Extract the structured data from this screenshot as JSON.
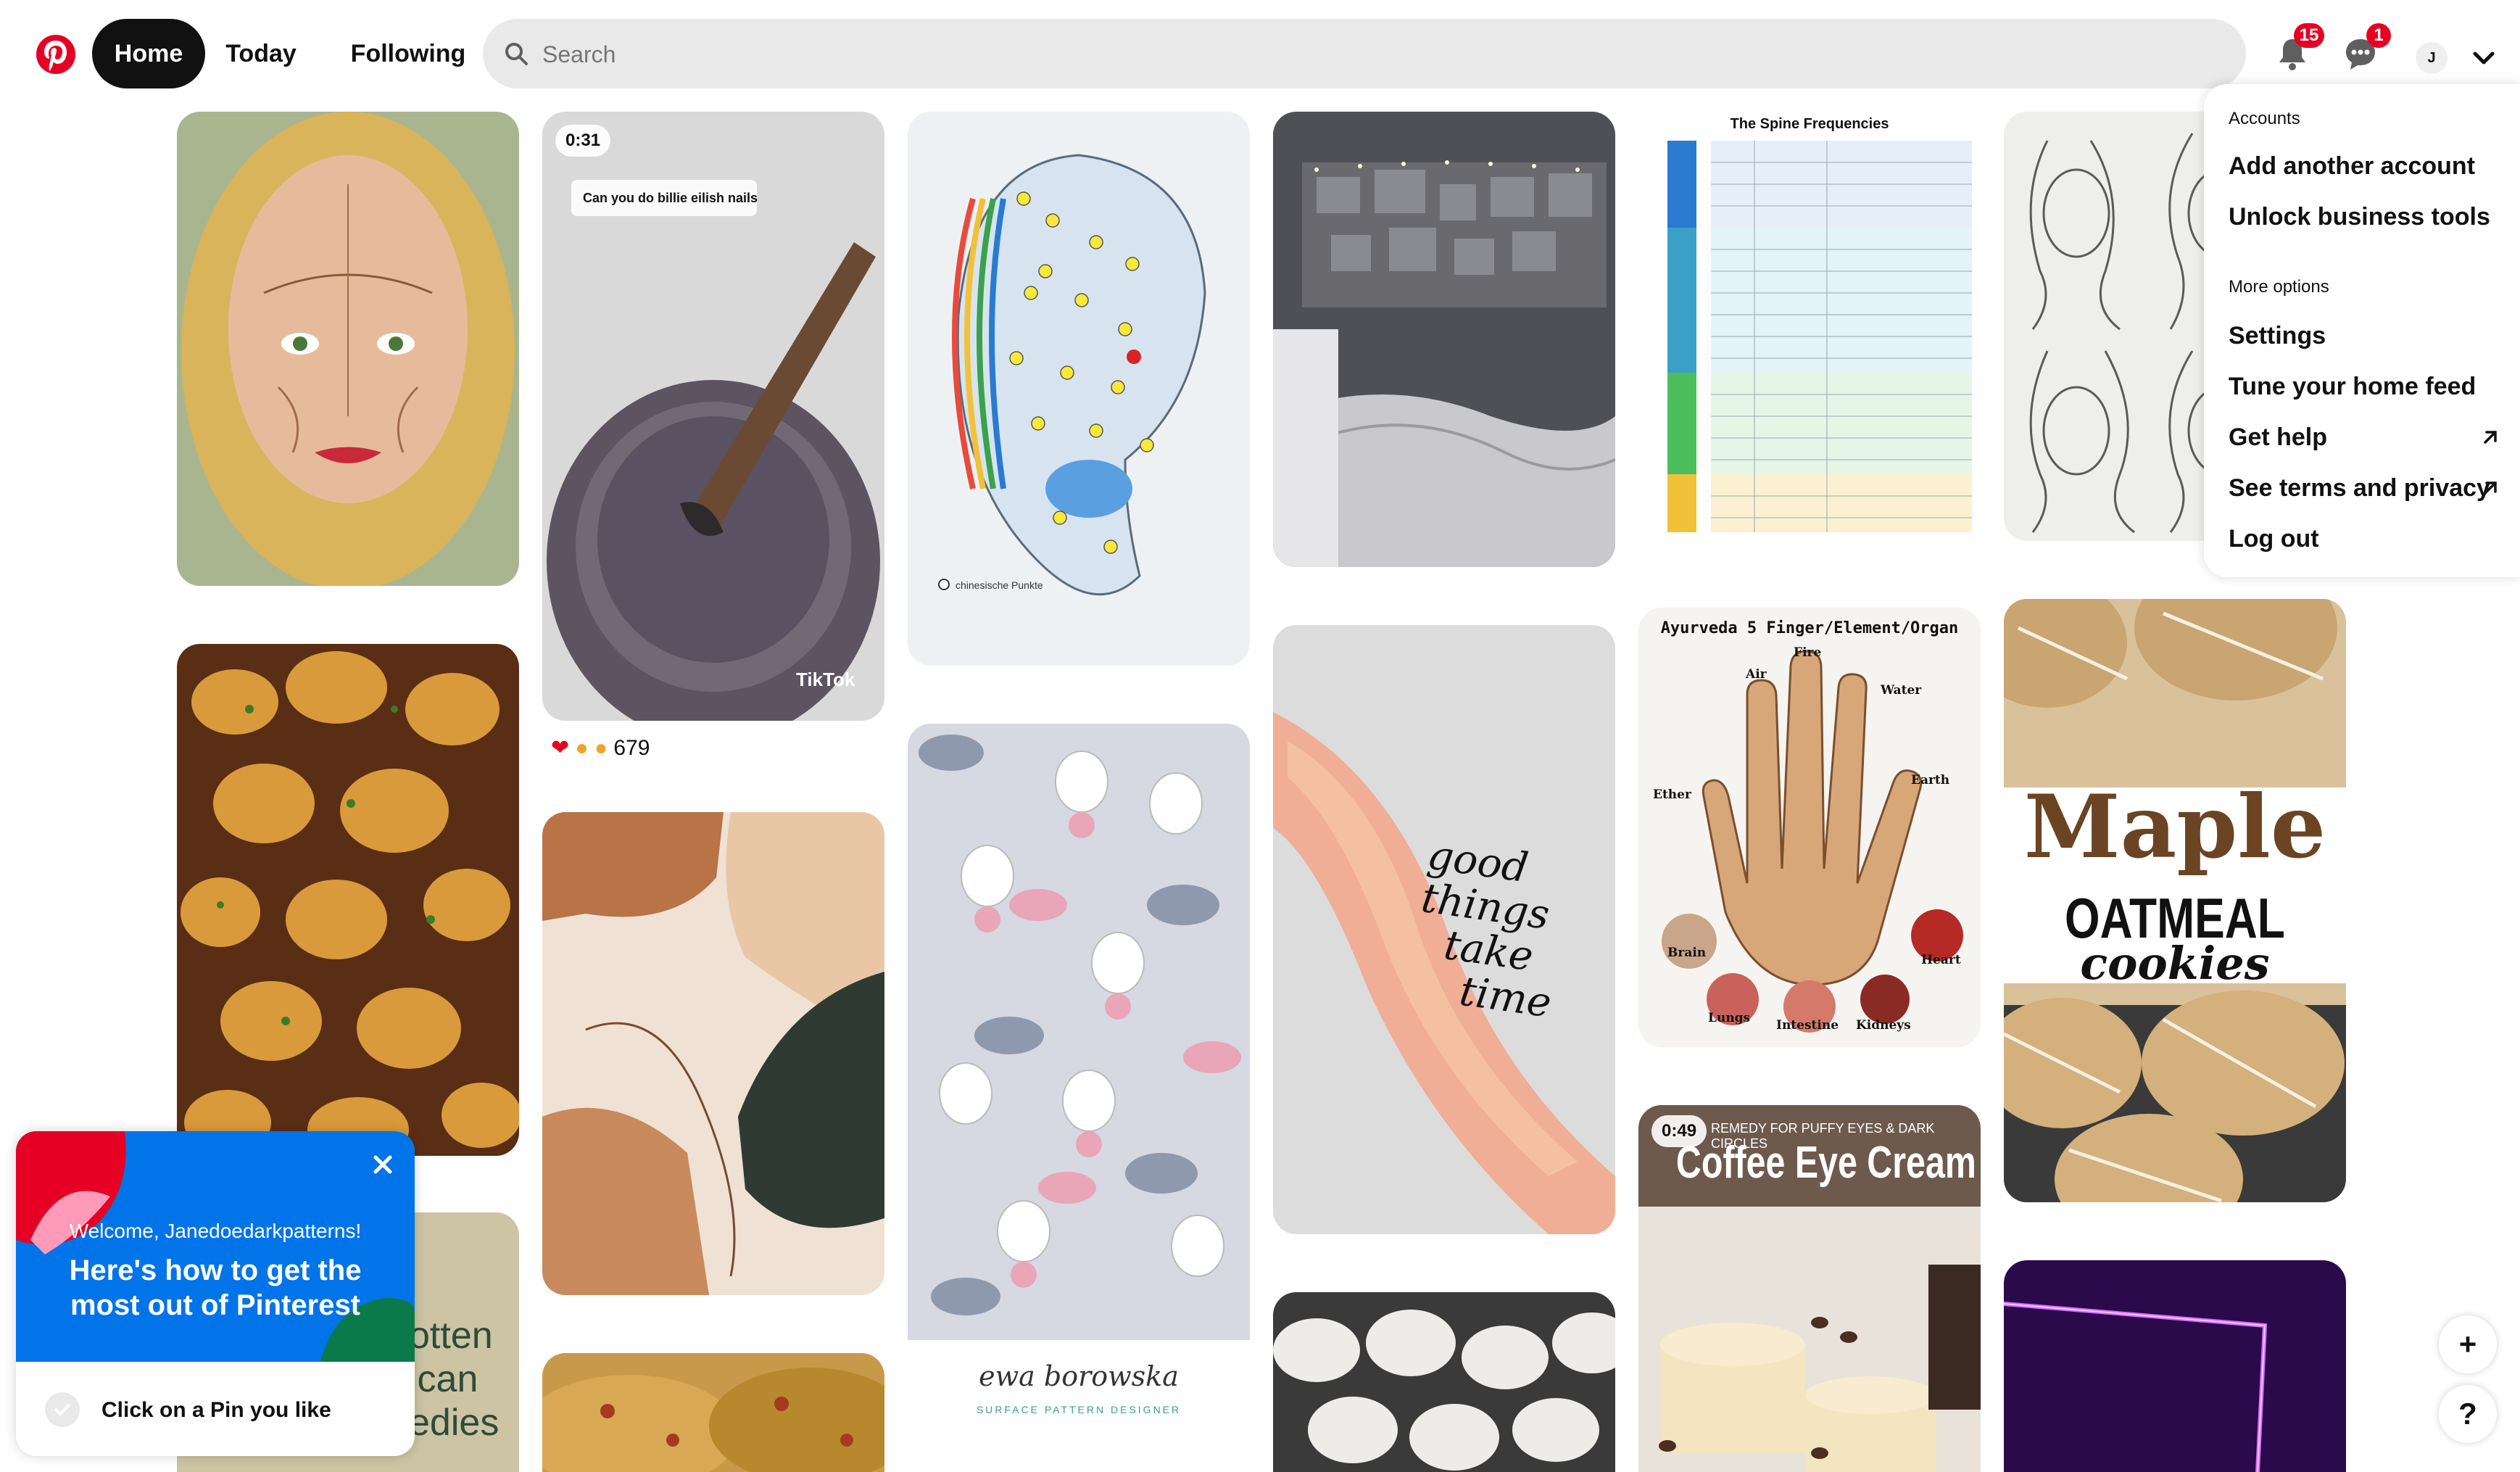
{
  "nav": {
    "home": "Home",
    "today": "Today",
    "following": "Following"
  },
  "search": {
    "placeholder": "Search"
  },
  "header": {
    "notifications_count": "15",
    "messages_count": "1",
    "avatar_initial": "J"
  },
  "pins": {
    "video1": {
      "duration": "0:31",
      "reply_text": "Can you do billie eilish nails",
      "source": "TikTok",
      "reaction_count": "679"
    },
    "ear": {
      "note": "chinesische Punkte"
    },
    "spine": {
      "title": "The Spine Frequencies"
    },
    "affirmation": {
      "line1": "good",
      "line2": "things",
      "line3": "take",
      "line4": "time"
    },
    "ayurveda": {
      "title": "Ayurveda 5 Finger/Element/Organ",
      "fire": "Fire",
      "air": "Air",
      "water": "Water",
      "ether": "Ether",
      "earth": "Earth",
      "brain": "Brain",
      "lungs": "Lungs",
      "intestine": "Intestine",
      "kidneys": "Kidneys",
      "heart": "Heart"
    },
    "cookies": {
      "line1": "Maple",
      "line2": "OATMEAL",
      "line3": "cookies"
    },
    "coffee": {
      "duration": "0:49",
      "tagline": "REMEDY FOR PUFFY EYES & DARK CIRCLES",
      "title": "Coffee Eye Cream"
    },
    "pattern": {
      "designer": "ewa borowska",
      "subtitle": "SURFACE PATTERN DESIGNER"
    },
    "remedies": {
      "text1": "otten",
      "text2": "ican",
      "text3": "edies"
    }
  },
  "menu": {
    "accounts_heading": "Accounts",
    "add_account": "Add another account",
    "unlock_business": "Unlock business tools",
    "more_heading": "More options",
    "settings": "Settings",
    "tune_feed": "Tune your home feed",
    "get_help": "Get help",
    "terms": "See terms and privacy",
    "logout": "Log out"
  },
  "onboarding": {
    "welcome": "Welcome, Janedoedarkpatterns!",
    "headline": "Here's how to get the most out of Pinterest",
    "step1": "Click on a Pin you like"
  },
  "colors": {
    "brand": "#e60023",
    "onboard_blue": "#0074e8"
  },
  "icons": [
    "pinterest-logo",
    "search-icon",
    "bell-icon",
    "chat-icon",
    "chevron-down-icon",
    "external-link-icon",
    "close-icon",
    "plus-icon",
    "help-icon"
  ]
}
